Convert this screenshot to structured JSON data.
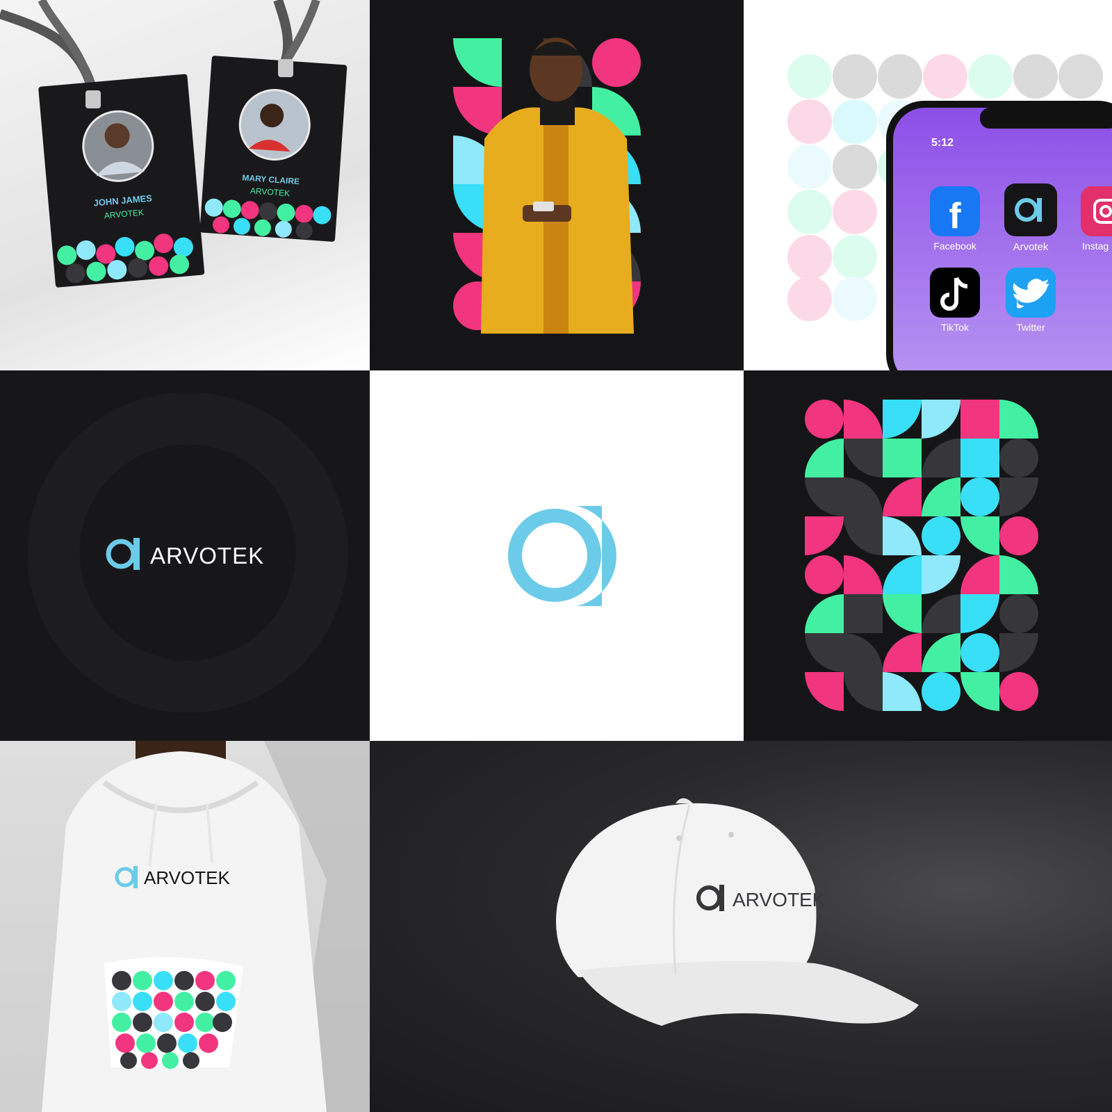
{
  "brand": {
    "name": "ARVOTEK",
    "colors": {
      "primary_blue": "#6ccbe8",
      "pink": "#f2357f",
      "mint": "#43f0a3",
      "cyan": "#38dff7",
      "light_cyan": "#8fe9fb",
      "charcoal": "#37373b",
      "dark_bg": "#151517"
    }
  },
  "badges": [
    {
      "name": "JOHN JAMES",
      "company": "ARVOTEK"
    },
    {
      "name": "MARY CLAIRE",
      "company": "ARVOTEK"
    }
  ],
  "phone": {
    "time": "5:12",
    "apps": [
      {
        "label": "Facebook",
        "icon": "facebook-icon"
      },
      {
        "label": "Arvotek",
        "icon": "arvotek-logo-icon"
      },
      {
        "label": "Instag",
        "icon": "instagram-icon"
      },
      {
        "label": "TikTok",
        "icon": "tiktok-icon"
      },
      {
        "label": "Twitter",
        "icon": "twitter-icon"
      }
    ]
  },
  "logo_dark": {
    "wordmark": "ARVOTEK"
  },
  "hoodie": {
    "wordmark": "ARVOTEK"
  },
  "cap": {
    "wordmark": "ARVOTEK"
  }
}
